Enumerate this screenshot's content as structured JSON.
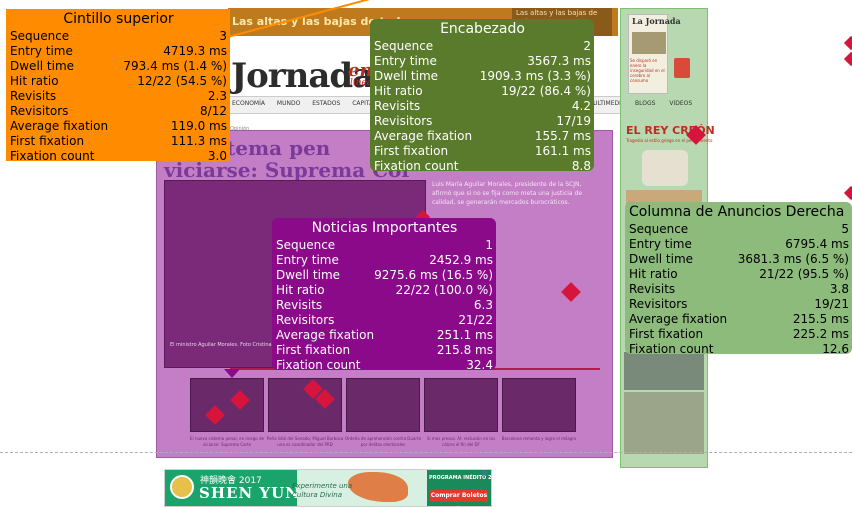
{
  "page": {
    "top_banner": "Las altas y las bajas de todo",
    "top_thumb_text": "Las altas y las bajas de todo",
    "logo": "Jornada",
    "logo_suffix": "en",
    "logo_sub": "línea",
    "nav_items": [
      "ECONOMÍA",
      "MUNDO",
      "ESTADOS",
      "CAPITAL"
    ],
    "nav_right": "MULTIMEDIA",
    "small_label": "Opinión",
    "headline_line1": "vo sistema pen",
    "headline_line2": "viciarse: Suprema Cor",
    "lead_text": "Luis María Aguilar Morales, presidente de la SCJN, afirmó que si no se fija como meta una justicia de calidad, se generarán mercados burocráticos.",
    "lead_caption": "El ministro Aguilar Morales. Foto Cristina",
    "thumb_captions": [
      "El nuevo sistema penal, en riesgo de viciarse: Suprema Corte",
      "Peña lidió del Senado; Miguel Barbosa una es coordinador del PRD",
      "Ordeña de aprehensión contra Duarte por delitos electorales",
      "Si mas presos. AI: reclusión en los cálces el fin del DF",
      "Barcelona remonta y logra el milagro"
    ],
    "right_col": {
      "paper_title": "La Jornada",
      "paper_txt": "Se disparó en enero la inseguridad en el cerebro al consumo",
      "blogs": "BLOGS",
      "videos": "VIDEOS",
      "rey_creon": "EL REY CREÓN",
      "rey_sub": "Tragedia al estilo griego en el pensamiento"
    },
    "ad": {
      "cn_text": "神韻晚會 2017",
      "brand": "SHEN YUN",
      "mid_line1": "Experimente una",
      "mid_line2": "Cultura Divina",
      "right_top": "PROGRAMA INÉDITO 2017",
      "cta": "Comprar Boletos ▸",
      "close": "⊠"
    }
  },
  "stats": {
    "cintillo": {
      "title": "Cintillo superior",
      "rows": [
        {
          "label": "Sequence",
          "value": "3"
        },
        {
          "label": "Entry time",
          "value": "4719.3 ms"
        },
        {
          "label": "Dwell time",
          "value": "793.4 ms (1.4 %)"
        },
        {
          "label": "Hit ratio",
          "value": "12/22 (54.5 %)"
        },
        {
          "label": "Revisits",
          "value": "2.3"
        },
        {
          "label": "Revisitors",
          "value": "8/12"
        },
        {
          "label": "Average fixation",
          "value": "119.0 ms"
        },
        {
          "label": "First fixation",
          "value": "111.3 ms"
        },
        {
          "label": "Fixation count",
          "value": "3.0"
        }
      ]
    },
    "encabezado": {
      "title": "Encabezado",
      "rows": [
        {
          "label": "Sequence",
          "value": "2"
        },
        {
          "label": "Entry time",
          "value": "3567.3 ms"
        },
        {
          "label": "Dwell time",
          "value": "1909.3 ms (3.3 %)"
        },
        {
          "label": "Hit ratio",
          "value": "19/22 (86.4 %)"
        },
        {
          "label": "Revisits",
          "value": "4.2"
        },
        {
          "label": "Revisitors",
          "value": "17/19"
        },
        {
          "label": "Average fixation",
          "value": "155.7 ms"
        },
        {
          "label": "First fixation",
          "value": "161.1 ms"
        },
        {
          "label": "Fixation count",
          "value": "8.8"
        }
      ]
    },
    "noticias": {
      "title": "Noticias Importantes",
      "rows": [
        {
          "label": "Sequence",
          "value": "1"
        },
        {
          "label": "Entry time",
          "value": "2452.9 ms"
        },
        {
          "label": "Dwell time",
          "value": "9275.6 ms (16.5 %)"
        },
        {
          "label": "Hit ratio",
          "value": "22/22 (100.0 %)"
        },
        {
          "label": "Revisits",
          "value": "6.3"
        },
        {
          "label": "Revisitors",
          "value": "21/22"
        },
        {
          "label": "Average fixation",
          "value": "251.1 ms"
        },
        {
          "label": "First fixation",
          "value": "215.8 ms"
        },
        {
          "label": "Fixation count",
          "value": "32.4"
        }
      ]
    },
    "columna": {
      "title": "Columna de Anuncios Derecha",
      "rows": [
        {
          "label": "Sequence",
          "value": "5"
        },
        {
          "label": "Entry time",
          "value": "6795.4 ms"
        },
        {
          "label": "Dwell time",
          "value": "3681.3 ms (6.5 %)"
        },
        {
          "label": "Hit ratio",
          "value": "21/22 (95.5 %)"
        },
        {
          "label": "Revisits",
          "value": "3.8"
        },
        {
          "label": "Revisitors",
          "value": "19/21"
        },
        {
          "label": "Average fixation",
          "value": "215.5 ms"
        },
        {
          "label": "First fixation",
          "value": "225.2 ms"
        },
        {
          "label": "Fixation count",
          "value": "12.6"
        }
      ]
    }
  },
  "colors": {
    "cintillo": "#ff8c00",
    "encabezado": "#5a7a2c",
    "noticias": "#8a0a8a",
    "columna": "#8cbb7c",
    "fixation_marker": "#d6143c"
  }
}
